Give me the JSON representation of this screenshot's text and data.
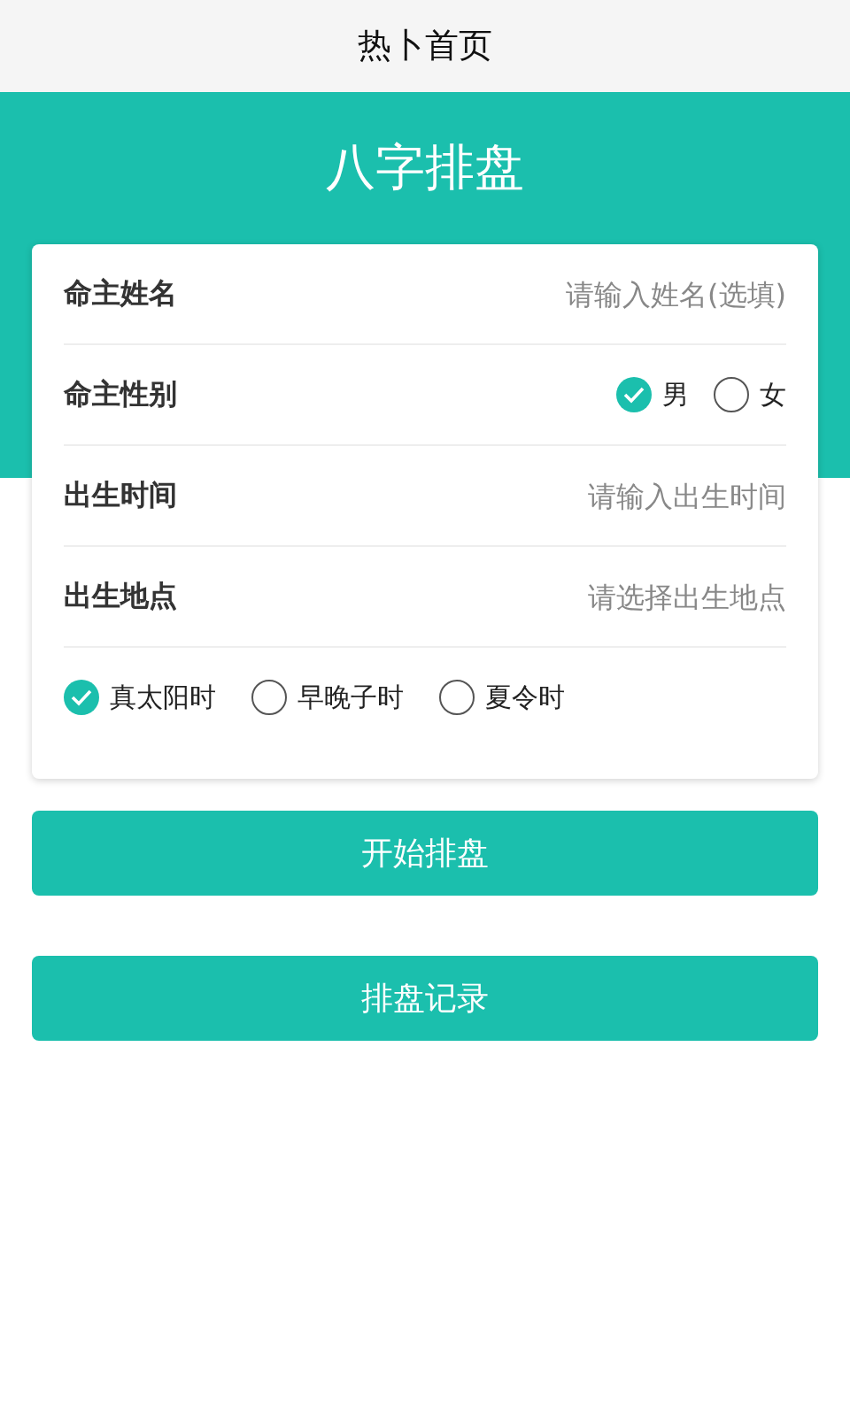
{
  "header": {
    "title": "热卜首页"
  },
  "banner": {
    "title": "八字排盘"
  },
  "form": {
    "rows": [
      {
        "kind": "input",
        "label": "命主姓名",
        "placeholder": "请输入姓名(选填)"
      },
      {
        "kind": "radio",
        "label": "命主性别",
        "options": [
          {
            "label": "男",
            "selected": true
          },
          {
            "label": "女",
            "selected": false
          }
        ]
      },
      {
        "kind": "input",
        "label": "出生时间",
        "placeholder": "请输入出生时间"
      },
      {
        "kind": "input",
        "label": "出生地点",
        "placeholder": "请选择出生地点"
      }
    ],
    "options": [
      {
        "label": "真太阳时",
        "checked": true
      },
      {
        "label": "早晚子时",
        "checked": false
      },
      {
        "label": "夏令时",
        "checked": false
      }
    ]
  },
  "buttons": [
    "开始排盘",
    "排盘记录"
  ]
}
